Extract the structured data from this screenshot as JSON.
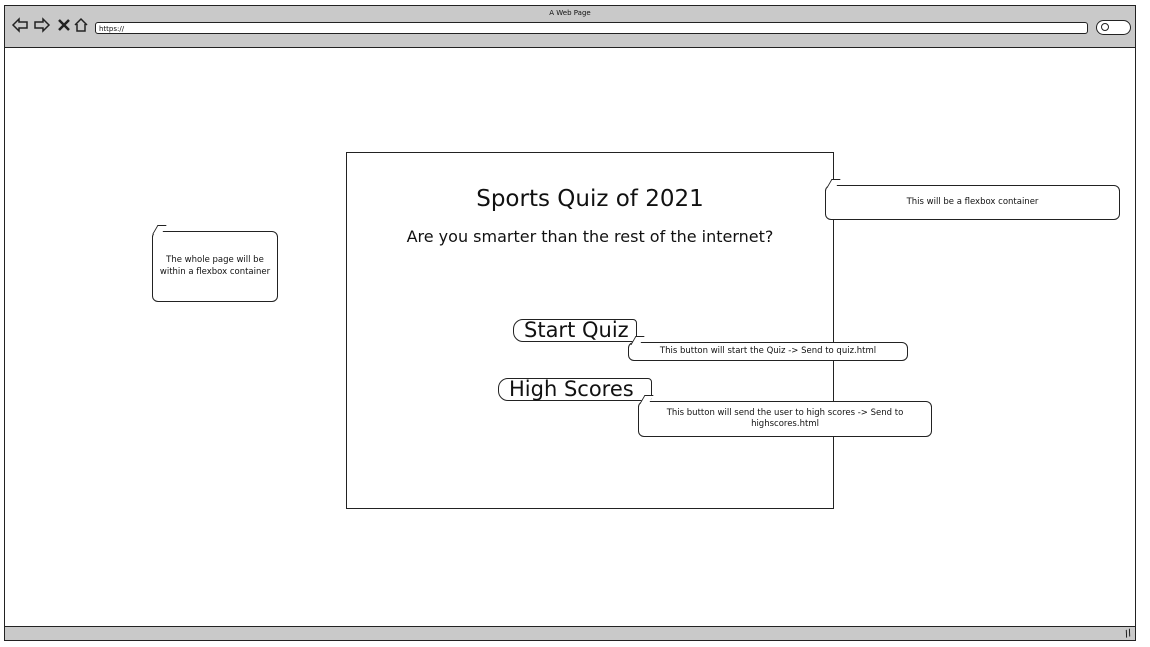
{
  "browser": {
    "window_title": "A Web Page",
    "url": "https://",
    "icons": [
      "back-arrow-icon",
      "forward-arrow-icon",
      "close-x-icon",
      "home-icon",
      "search-icon",
      "resize-grip-icon"
    ]
  },
  "quiz": {
    "title": "Sports Quiz of 2021",
    "subtitle": "Are you smarter than the rest of the internet?",
    "start_button": "Start Quiz",
    "scores_button": "High Scores"
  },
  "annotations": {
    "page_container": "The whole page will be within a flexbox container",
    "flex_container": "This will be a flexbox container",
    "start_note": "This button will start the Quiz -> Send to quiz.html",
    "scores_note": "This button will send the user to high scores -> Send to highscores.html"
  }
}
